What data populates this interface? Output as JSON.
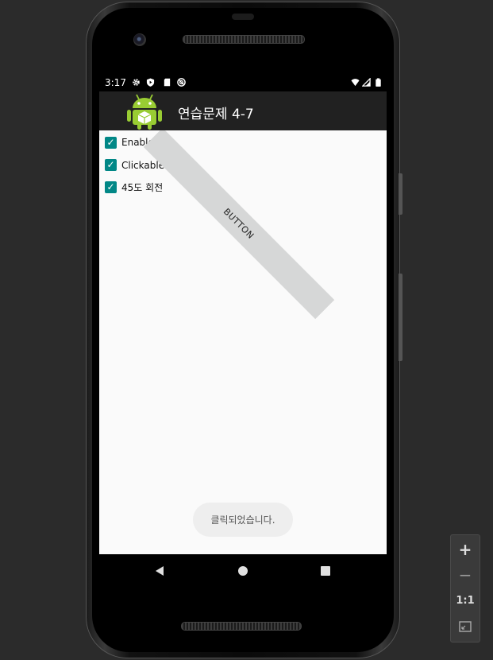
{
  "status_bar": {
    "time": "3:17",
    "left_icons": [
      "gear-icon",
      "play-protect-icon",
      "sd-card-icon",
      "sync-icon"
    ],
    "right_icons": [
      "wifi-icon",
      "signal-icon",
      "battery-icon"
    ]
  },
  "app_bar": {
    "title": "연습문제 4-7",
    "icon": "android-robot-icon"
  },
  "checkboxes": [
    {
      "label": "Enabled",
      "checked": true
    },
    {
      "label": "Clickable 속성",
      "checked": true
    },
    {
      "label": "45도 회전",
      "checked": true
    }
  ],
  "button": {
    "label": "BUTTON",
    "rotation_degrees": 45
  },
  "toast": {
    "text": "클릭되었습니다."
  },
  "nav_bar": {
    "icons": [
      "back-icon",
      "home-icon",
      "recents-icon"
    ]
  },
  "zoom_panel": {
    "zoom_in_label": "+",
    "zoom_out_label": "−",
    "actual_size_label": "1:1",
    "fit_icon": "fit-screen-icon"
  },
  "colors": {
    "app_bar": "#212121",
    "checkbox_accent": "#018786",
    "button_bg": "#d6d7d7",
    "content_bg": "#fafafa"
  }
}
